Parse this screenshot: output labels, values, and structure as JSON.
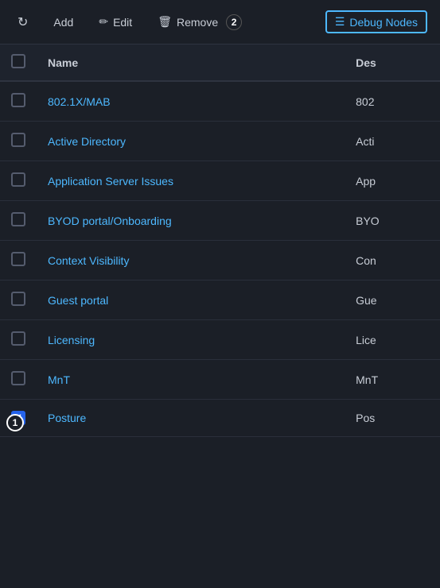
{
  "toolbar": {
    "refresh_label": "↻",
    "add_label": "Add",
    "edit_icon": "✏",
    "edit_label": "Edit",
    "remove_icon": "🗑",
    "remove_label": "Remove",
    "remove_badge": "2",
    "debug_icon": "☰",
    "debug_label": "Debug Nodes"
  },
  "table": {
    "col_name": "Name",
    "col_desc": "Des",
    "rows": [
      {
        "id": "row-1",
        "name": "802.1X/MAB",
        "desc": "802",
        "checked": false
      },
      {
        "id": "row-2",
        "name": "Active Directory",
        "desc": "Acti",
        "checked": false
      },
      {
        "id": "row-3",
        "name": "Application Server Issues",
        "desc": "App",
        "checked": false
      },
      {
        "id": "row-4",
        "name": "BYOD portal/Onboarding",
        "desc": "BYO",
        "checked": false
      },
      {
        "id": "row-5",
        "name": "Context Visibility",
        "desc": "Con",
        "checked": false
      },
      {
        "id": "row-6",
        "name": "Guest portal",
        "desc": "Gue",
        "checked": false
      },
      {
        "id": "row-7",
        "name": "Licensing",
        "desc": "Lice",
        "checked": false
      },
      {
        "id": "row-8",
        "name": "MnT",
        "desc": "MnT",
        "checked": false
      },
      {
        "id": "row-9",
        "name": "Posture",
        "desc": "Pos",
        "checked": true
      }
    ],
    "bottom_badge": "1"
  }
}
